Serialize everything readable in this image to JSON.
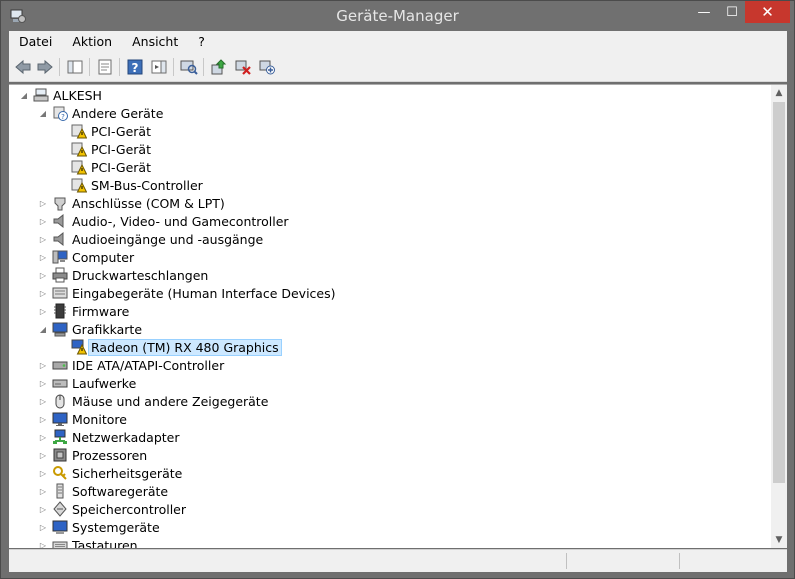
{
  "window": {
    "title": "Geräte-Manager",
    "controls": {
      "minimize": "—",
      "maximize": "☐",
      "close": "✕"
    }
  },
  "menu": [
    "Datei",
    "Aktion",
    "Ansicht",
    "?"
  ],
  "toolbar": [
    "back-icon",
    "forward-icon",
    "show-hide-tree-icon",
    "properties-icon",
    "help-icon",
    "action-pane-icon",
    "scan-hardware-icon",
    "update-driver-icon",
    "uninstall-device-icon",
    "add-legacy-hardware-icon"
  ],
  "tree": {
    "root": "ALKESH",
    "nodes": [
      {
        "label": "Andere Geräte",
        "icon": "unknown-device-icon",
        "expanded": true,
        "children": [
          {
            "label": "PCI-Gerät",
            "icon": "warning-device-icon"
          },
          {
            "label": "PCI-Gerät",
            "icon": "warning-device-icon"
          },
          {
            "label": "PCI-Gerät",
            "icon": "warning-device-icon"
          },
          {
            "label": "SM-Bus-Controller",
            "icon": "warning-device-icon"
          }
        ]
      },
      {
        "label": "Anschlüsse (COM & LPT)",
        "icon": "port-icon"
      },
      {
        "label": "Audio-, Video- und Gamecontroller",
        "icon": "speaker-icon"
      },
      {
        "label": "Audioeingänge und -ausgänge",
        "icon": "speaker-icon"
      },
      {
        "label": "Computer",
        "icon": "computer-icon"
      },
      {
        "label": "Druckwarteschlangen",
        "icon": "printer-icon"
      },
      {
        "label": "Eingabegeräte (Human Interface Devices)",
        "icon": "hid-icon"
      },
      {
        "label": "Firmware",
        "icon": "firmware-icon"
      },
      {
        "label": "Grafikkarte",
        "icon": "display-adapter-icon",
        "expanded": true,
        "children": [
          {
            "label": "Radeon (TM) RX 480 Graphics",
            "icon": "warning-display-icon",
            "selected": true
          }
        ]
      },
      {
        "label": "IDE ATA/ATAPI-Controller",
        "icon": "ide-icon"
      },
      {
        "label": "Laufwerke",
        "icon": "drive-icon"
      },
      {
        "label": "Mäuse und andere Zeigegeräte",
        "icon": "mouse-icon"
      },
      {
        "label": "Monitore",
        "icon": "monitor-icon"
      },
      {
        "label": "Netzwerkadapter",
        "icon": "network-icon"
      },
      {
        "label": "Prozessoren",
        "icon": "processor-icon"
      },
      {
        "label": "Sicherheitsgeräte",
        "icon": "security-icon"
      },
      {
        "label": "Softwaregeräte",
        "icon": "software-device-icon"
      },
      {
        "label": "Speichercontroller",
        "icon": "storage-icon"
      },
      {
        "label": "Systemgeräte",
        "icon": "system-icon"
      },
      {
        "label": "Tastaturen",
        "icon": "keyboard-icon"
      }
    ]
  },
  "colors": {
    "selection": "#cde8ff",
    "selection_border": "#99d1ff",
    "titlebar": "#707070",
    "close": "#c7372d",
    "warning": "#f2c200"
  }
}
